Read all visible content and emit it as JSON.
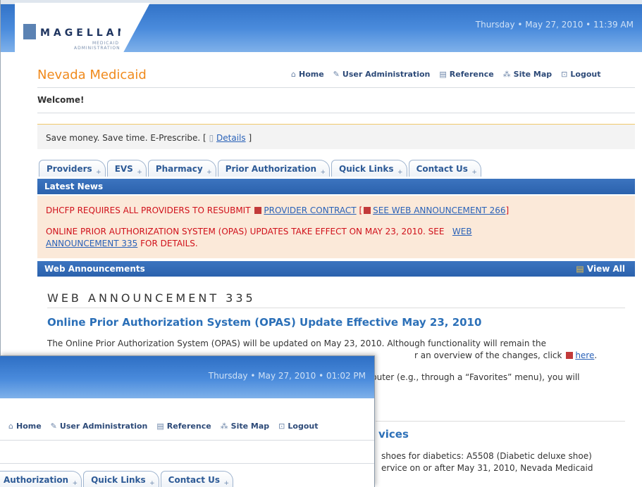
{
  "main": {
    "date_time": "Thursday • May 27, 2010 • 11:39 AM",
    "logo": {
      "name": "MAGELLAN",
      "sub_line1": "MEDICAID",
      "sub_line2": "ADMINISTRATION"
    },
    "site_title": "Nevada Medicaid",
    "nav": [
      {
        "icon": "home-icon",
        "label": "Home"
      },
      {
        "icon": "pencil-icon",
        "label": "User Administration"
      },
      {
        "icon": "book-icon",
        "label": "Reference"
      },
      {
        "icon": "sitemap-icon",
        "label": "Site Map"
      },
      {
        "icon": "lock-icon",
        "label": "Logout"
      }
    ],
    "welcome": "Welcome!",
    "promo": {
      "text": "Save money. Save time. E-Prescribe. [",
      "link": "Details",
      "close": "]"
    },
    "tabs": [
      "Providers",
      "EVS",
      "Pharmacy",
      "Prior Authorization",
      "Quick Links",
      "Contact Us"
    ],
    "latest_news_label": "Latest News",
    "news": {
      "line1_text": "DHCFP REQUIRES ALL PROVIDERS TO RESUBMIT",
      "line1_link1": "PROVIDER CONTRACT",
      "line1_bracket": "[",
      "line1_link2": "SEE WEB ANNOUNCEMENT 266",
      "line1_end": "]",
      "line2_text": "ONLINE PRIOR AUTHORIZATION SYSTEM (OPAS) UPDATES TAKE EFFECT ON MAY 23, 2010.  SEE",
      "line2_link_a": "WEB",
      "line2_link_b": "ANNOUNCEMENT 335",
      "line2_end": "FOR DETAILS."
    },
    "web_announcements_label": "Web Announcements",
    "view_all": "View All",
    "announcement": {
      "heading": "WEB ANNOUNCEMENT 335",
      "title": "Online Prior Authorization System (OPAS) Update Effective May 23, 2010",
      "body1": "The Online Prior Authorization System (OPAS) will be updated on May 23, 2010. Although functionality will remain the",
      "body2_end": "r an overview of the changes, click",
      "here": "here",
      "body2_period": ".",
      "body3_end": "puter (e.g., through a “Favorites” menu), you will"
    },
    "section2_title_fragment": "vices",
    "frag1": "shoes for diabetics: A5508 (Diabetic deluxe shoe)",
    "frag2": "ervice on or after May 31, 2010, Nevada Medicaid"
  },
  "front": {
    "date_time": "Thursday • May 27, 2010 • 01:02 PM",
    "nav": [
      {
        "icon": "home-icon",
        "label": "Home"
      },
      {
        "icon": "pencil-icon",
        "label": "User Administration"
      },
      {
        "icon": "book-icon",
        "label": "Reference"
      },
      {
        "icon": "sitemap-icon",
        "label": "Site Map"
      },
      {
        "icon": "lock-icon",
        "label": "Logout"
      }
    ],
    "tabs": [
      "Authorization",
      "Quick Links",
      "Contact Us"
    ]
  },
  "colors": {
    "accent_orange": "#f08a1c",
    "nav_blue": "#2d4a78",
    "bar_blue": "#2b62ad",
    "news_red": "#d0101a",
    "news_bg": "#fbe9d9",
    "link_blue": "#2a62b8"
  }
}
